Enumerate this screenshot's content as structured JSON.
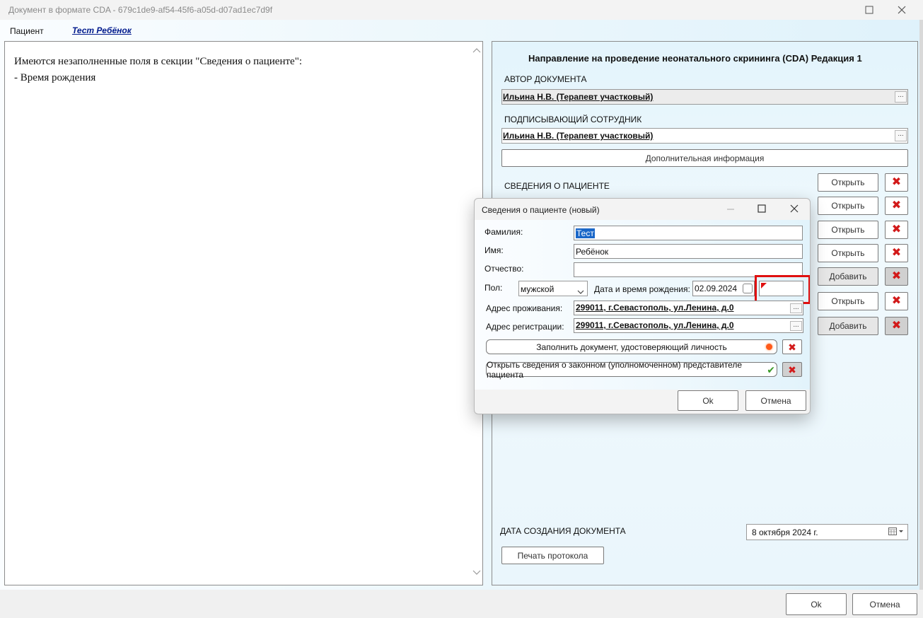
{
  "window": {
    "title": "Документ в формате CDA - 679c1de9-af54-45f6-a05d-d07ad1ec7d9f"
  },
  "menu": {
    "patient_label": "Пациент",
    "patient_name": "Тест Ребёнок"
  },
  "messages": {
    "line1": "Имеются незаполненные поля в секции \"Сведения о пациенте\":",
    "line2": "- Время рождения"
  },
  "form": {
    "title": "Направление на проведение неонатального скрининга (CDA) Редакция 1",
    "author_label": "АВТОР ДОКУМЕНТА",
    "author_value": "Ильина Н.В. (Терапевт участковый)",
    "signer_label": "ПОДПИСЫВАЮЩИЙ СОТРУДНИК",
    "signer_value": "Ильина Н.В. (Терапевт участковый)",
    "additional_info": "Дополнительная информация",
    "patient_section_label": "СВЕДЕНИЯ О ПАЦИЕНТЕ",
    "dots": "...",
    "section_buttons": [
      "Открыть",
      "Открыть",
      "Открыть",
      "Открыть",
      "Добавить",
      "Открыть",
      "Добавить"
    ],
    "creation_date_label": "ДАТА СОЗДАНИЯ ДОКУМЕНТА",
    "creation_date_value": "8  октября  2024 г.",
    "print_protocol": "Печать протокола"
  },
  "footer": {
    "ok": "Ok",
    "cancel": "Отмена"
  },
  "dialog": {
    "title": "Сведения о пациенте (новый)",
    "surname_label": "Фамилия:",
    "surname_value": "Тест",
    "name_label": "Имя:",
    "name_value": "Ребёнок",
    "patronymic_label": "Отчество:",
    "patronymic_value": "",
    "sex_label": "Пол:",
    "sex_value": "мужской",
    "birth_label": "Дата и время рождения:",
    "birth_date": "02.09.2024",
    "birth_time": "",
    "address_live_label": "Адрес проживания:",
    "address_live_value": "299011, г.Севастополь, ул.Ленина, д.0",
    "address_reg_label": "Адрес регистрации:",
    "address_reg_value": "299011, г.Севастополь, ул.Ленина, д.0",
    "fill_id_doc": "Заполнить документ, удостоверяющий личность",
    "open_rep": "Открыть сведения о законном (уполномоченном) представителе пациента",
    "ok": "Ok",
    "cancel": "Отмена"
  },
  "colors": {
    "highlight_border": "#e01010",
    "link": "#001a8c",
    "delete_icon": "#d21a1a"
  }
}
